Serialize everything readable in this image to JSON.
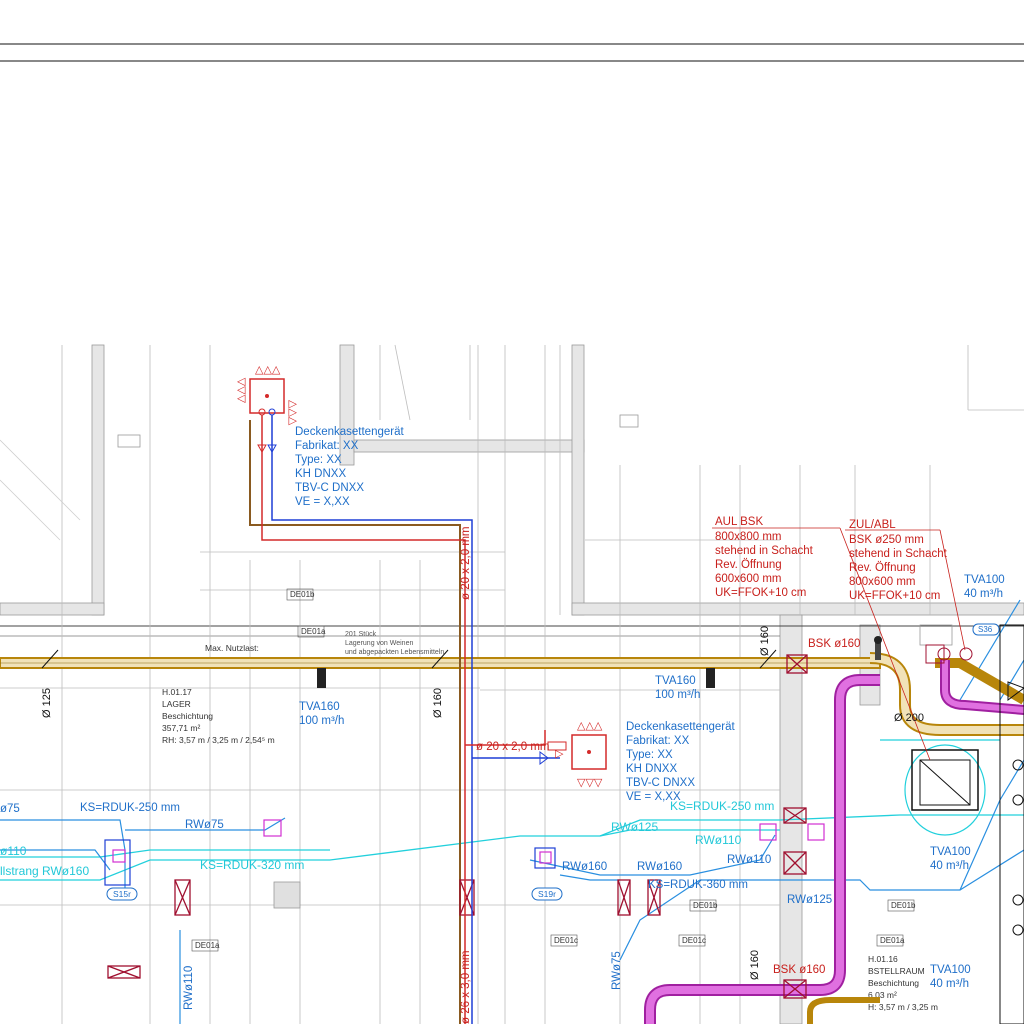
{
  "colors": {
    "supply_brown": "#b8860b",
    "exhaust_magenta": "#d12fd1",
    "refrigerant_red": "#d42a2a",
    "refrigerant_blue": "#1f3fd6",
    "rw_blue": "#2a8fe0",
    "ks_cyan": "#22d0dc",
    "linework_gray": "#9a9a9a"
  },
  "equipment": {
    "unit_1": {
      "line1": "Deckenkasettengerät",
      "line2": "Fabrikat: XX",
      "line3": "Type: XX",
      "line4": "KH DNXX",
      "line5": "TBV-C DNXX",
      "line6": "VE = X,XX"
    },
    "unit_2": {
      "line1": "Deckenkasettengerät",
      "line2": "Fabrikat: XX",
      "line3": "Type: XX",
      "line4": "KH DNXX",
      "line5": "TBV-C DNXX",
      "line6": "VE = X,XX"
    }
  },
  "shafts": {
    "aul": {
      "title": "AUL BSK",
      "line1": "800x800 mm",
      "line2": "stehend in Schacht",
      "line3": "Rev. Öffnung",
      "line4": "600x600 mm",
      "line5": "UK=FFOK+10 cm"
    },
    "zul": {
      "title": "ZUL/ABL",
      "line1": "BSK ø250 mm",
      "line2": "stehend in Schacht",
      "line3": "Rev. Öffnung",
      "line4": "800x600 mm",
      "line5": "UK=FFOK+10 cm"
    }
  },
  "valves": {
    "tva_a": {
      "name": "TVA160",
      "flow": "100 m³/h"
    },
    "tva_b": {
      "name": "TVA160",
      "flow": "100 m³/h"
    },
    "tva_c": {
      "name": "TVA100",
      "flow": "40 m³/h"
    },
    "tva_d": {
      "name": "TVA100",
      "flow": "40 m³/h"
    },
    "tva_e": {
      "name": "TVA100",
      "flow": "40 m³/h"
    }
  },
  "dampers": {
    "bsk_top": "BSK ø160",
    "bsk_bottom": "BSK ø160"
  },
  "dimensions": {
    "d125": "Ø 125",
    "d160_a": "Ø 160",
    "d160_b": "Ø 160",
    "d160_c": "Ø 160",
    "d200": "Ø 200"
  },
  "pipes": {
    "ref_top": "ø 20 x 2,0 mm",
    "ref_mid": "ø 20 x 2,0 mm",
    "ref_bot": "ø 26 x 3,0 mm"
  },
  "rainwater": {
    "rw75_a": "RWø75",
    "rw125_a": "RWø125",
    "rw110_a": "RWø110",
    "rw110_b": "RWø110",
    "rw160_a": "RWø160",
    "rw160_b": "RWø160",
    "rw125_b": "RWø125",
    "rw75_b": "RWø75",
    "rw110_c": "RWø110",
    "left_75": "ø75",
    "left_110": "ø110",
    "left_strang": "llstrang RWø160"
  },
  "cables": {
    "ks250_a": "KS=RDUK-250 mm",
    "ks250_b": "KS=RDUK-250 mm",
    "ks320": "KS=RDUK-320 mm",
    "ks360": "KS=RDUK-360 mm"
  },
  "rooms": {
    "lager": {
      "id": "H.01.17",
      "name": "LAGER",
      "desc": "Beschichtung",
      "area": "357,71 m²",
      "rh": "RH: 3,57 m / 3,25 m / 2,54⁵ m"
    },
    "bestell": {
      "id": "H.01.16",
      "name": "BSTELLRAUM",
      "desc": "Beschichtung",
      "area": "6,03 m²",
      "rh": "H: 3,57 m / 3,25 m"
    }
  },
  "notes": {
    "load": "Max. Nutzlast:",
    "pallets_1": "201 Stück",
    "pallets_2": "Lagerung von Weinen",
    "pallets_3": "und abgepackten Lebensmitteln."
  },
  "tags": {
    "s15r": "S15r",
    "s19r": "S19r",
    "s36": "S36",
    "de01b_a": "DE01b",
    "de01a_a": "DE01a",
    "de01a_b": "DE01a",
    "de01c": "DE01c",
    "de01b_b": "DE01b",
    "de01c_b": "DE01c",
    "de01b_c": "DE01b",
    "de01a_c": "DE01a"
  }
}
